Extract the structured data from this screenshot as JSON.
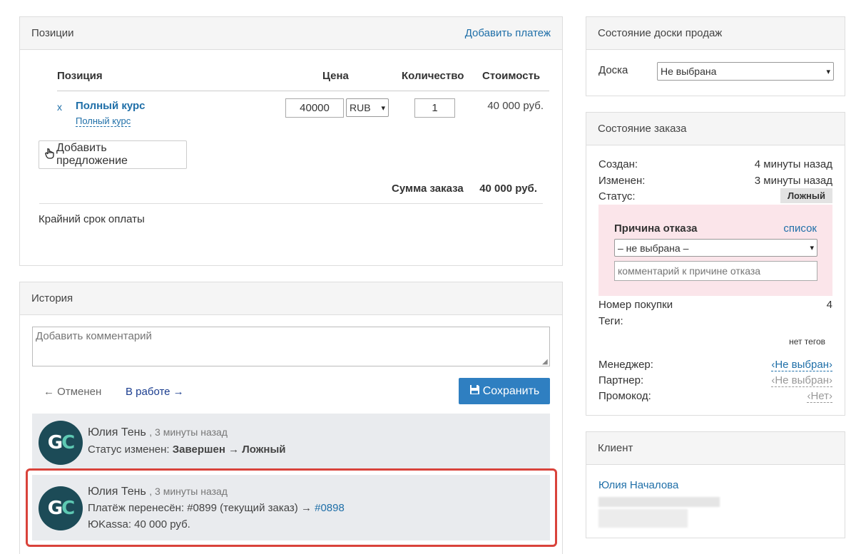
{
  "positions": {
    "title": "Позиции",
    "add_payment": "Добавить платеж",
    "columns": {
      "item": "Позиция",
      "price": "Цена",
      "qty": "Количество",
      "cost": "Стоимость"
    },
    "item": {
      "remove": "x",
      "name": "Полный курс",
      "sub": "Полный курс",
      "price": "40000",
      "currency": "RUB",
      "qty": "1",
      "cost": "40 000 руб."
    },
    "add_offer": "Добавить предложение",
    "total_label": "Сумма заказа",
    "total_value": "40 000 руб.",
    "deadline": "Крайний срок оплаты"
  },
  "history": {
    "title": "История",
    "comment_placeholder": "Добавить комментарий",
    "prev": "← Отменен",
    "next": "В работе →",
    "save": "Сохранить",
    "entries": [
      {
        "avatar": "GC",
        "author": "Юлия Тень",
        "time": ", 3 минуты назад",
        "line1_prefix": "Статус изменен: ",
        "line1_bold": "Завершен → Ложный"
      },
      {
        "avatar": "GC",
        "author": "Юлия Тень",
        "time": ", 3 минуты назад",
        "line1_prefix": "Платёж перенесён: #0899 (текущий заказ) → ",
        "line1_link": "#0898",
        "line2": "ЮKassa: 40 000 руб."
      }
    ]
  },
  "board": {
    "title": "Состояние доски продаж",
    "label": "Доска",
    "value": "Не выбрана"
  },
  "order": {
    "title": "Состояние заказа",
    "created_label": "Создан:",
    "created_value": "4 минуты назад",
    "changed_label": "Изменен:",
    "changed_value": "3 минуты назад",
    "status_label": "Статус:",
    "status_value": "Ложный",
    "reason_title": "Причина отказа",
    "reason_list": "список",
    "reason_select": "– не выбрана –",
    "reason_comment_placeholder": "комментарий к причине отказа",
    "purchase_label": "Номер покупки",
    "purchase_value": "4",
    "tags_label": "Теги:",
    "no_tags": "нет тегов",
    "manager_label": "Менеджер:",
    "manager_value": "‹Не выбран›",
    "partner_label": "Партнер:",
    "partner_value": "‹Не выбран›",
    "promo_label": "Промокод:",
    "promo_value": "‹Нет›"
  },
  "client": {
    "title": "Клиент",
    "name": "Юлия Началова"
  }
}
